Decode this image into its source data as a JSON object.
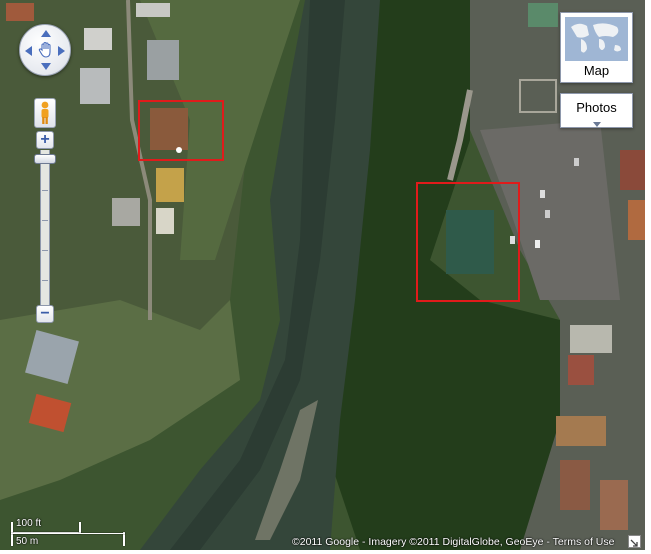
{
  "map": {
    "view": "satellite",
    "highlight_count": 2
  },
  "controls": {
    "pan_icon": "hand-icon",
    "pegman_icon": "street-view-pegman-icon",
    "zoom_in_label": "+",
    "zoom_out_label": "−",
    "map_type_button_label": "Map",
    "photos_button_label": "Photos"
  },
  "scale": {
    "imperial_label": "100 ft",
    "metric_label": "50 m"
  },
  "footer": {
    "copyright": "©2011 Google - Imagery ©2011 DigitalGlobe, GeoEye - Terms of Use"
  },
  "colors": {
    "highlight_box": "#e01b1b",
    "control_blue": "#4a6ebd",
    "river": "#3a4a3e",
    "vegetation": "#2f4a24"
  }
}
